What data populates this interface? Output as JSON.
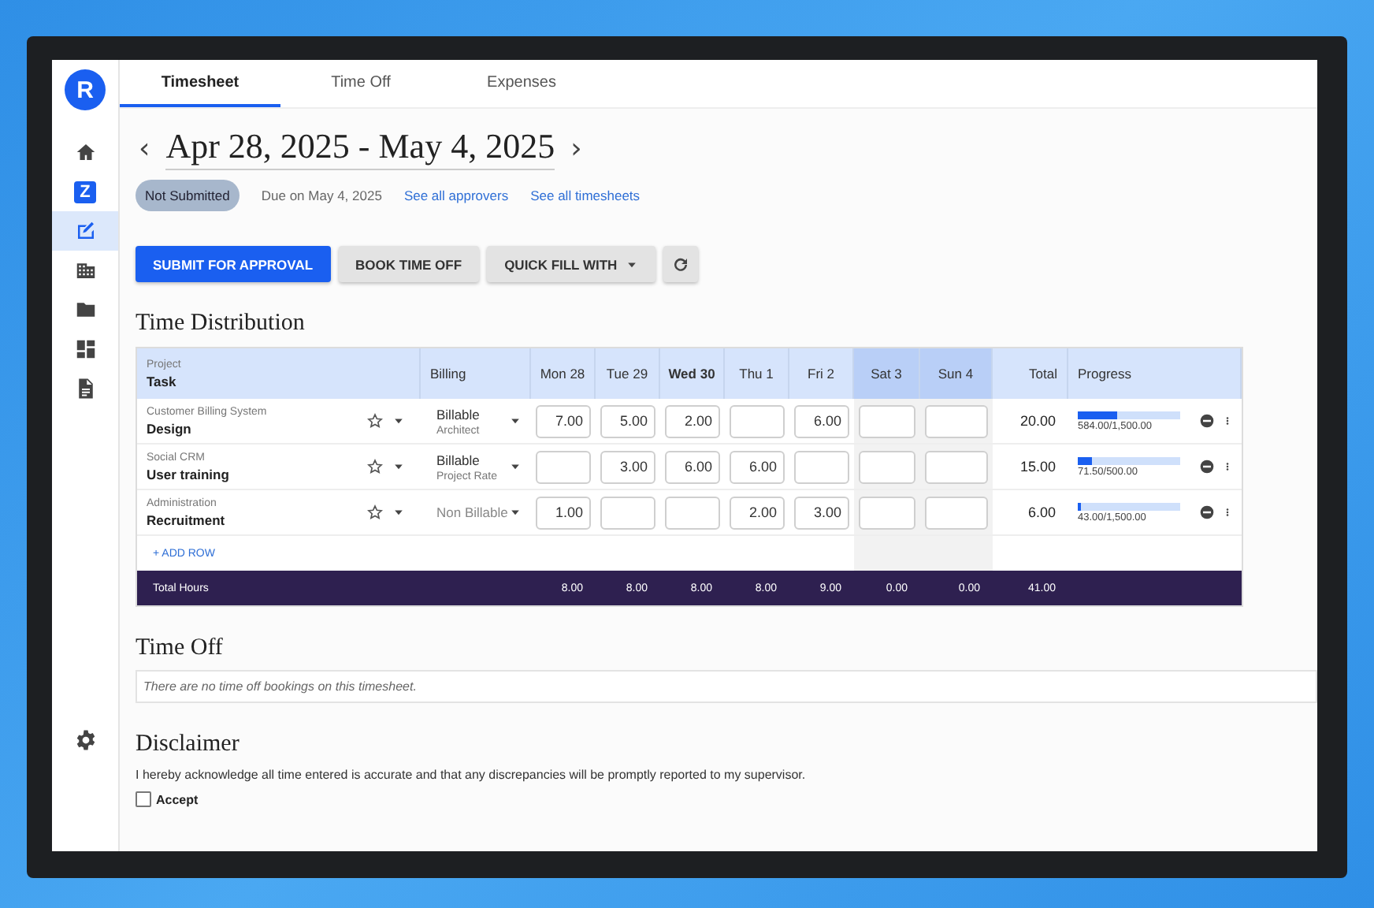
{
  "sidebar": {
    "logo": "R",
    "items": [
      {
        "kind": "home",
        "selected": false
      },
      {
        "kind": "letter",
        "text": "Z",
        "selected": false
      },
      {
        "kind": "timesheet",
        "selected": true
      },
      {
        "kind": "building",
        "selected": false
      },
      {
        "kind": "folder",
        "selected": false
      },
      {
        "kind": "dashboard",
        "selected": false
      },
      {
        "kind": "document",
        "selected": false
      }
    ],
    "bottom": {
      "kind": "settings",
      "selected": false
    }
  },
  "tabs": [
    {
      "label": "Timesheet",
      "selected": true
    },
    {
      "label": "Time Off",
      "selected": false
    },
    {
      "label": "Expenses",
      "selected": false
    }
  ],
  "period": {
    "prev": "‹",
    "title": "Apr 28, 2025 - May 4, 2025",
    "next": "›"
  },
  "status": {
    "chip": "Not Submitted",
    "due": "Due on May 4, 2025",
    "links": [
      "See all approvers",
      "See all timesheets"
    ]
  },
  "actions": [
    {
      "kind": "primary",
      "label": "SUBMIT FOR APPROVAL"
    },
    {
      "kind": "plain",
      "label": "BOOK TIME OFF"
    },
    {
      "kind": "menu",
      "label": "QUICK FILL WITH"
    },
    {
      "kind": "refresh"
    }
  ],
  "time_distribution": {
    "title": "Time Distribution",
    "header": {
      "project": "Project",
      "task": "Task",
      "billing": "Billing",
      "total": "Total",
      "progress": "Progress"
    },
    "days": [
      {
        "label": "Mon 28",
        "weekend": false,
        "current": false
      },
      {
        "label": "Tue 29",
        "weekend": false,
        "current": false
      },
      {
        "label": "Wed 30",
        "weekend": false,
        "current": true
      },
      {
        "label": "Thu 1",
        "weekend": false,
        "current": false
      },
      {
        "label": "Fri 2",
        "weekend": false,
        "current": false
      },
      {
        "label": "Sat 3",
        "weekend": true,
        "current": false
      },
      {
        "label": "Sun 4",
        "weekend": true,
        "current": false
      }
    ],
    "rows": [
      {
        "project": "Customer Billing System",
        "task": "Design",
        "starred": false,
        "billing": "Billable",
        "billable": true,
        "rate": "Architect",
        "hours": {
          "0": "7.00",
          "1": "5.00",
          "2": "2.00",
          "4": "6.00"
        },
        "total": "20.00",
        "level": 0.389,
        "progress": "584.00/1,500.00"
      },
      {
        "project": "Social CRM",
        "task": "User training",
        "starred": false,
        "billing": "Billable",
        "billable": true,
        "rate": "Project Rate",
        "hours": {
          "1": "3.00",
          "2": "6.00",
          "3": "6.00"
        },
        "total": "15.00",
        "level": 0.143,
        "progress": "71.50/500.00"
      },
      {
        "project": "Administration",
        "task": "Recruitment",
        "starred": false,
        "billing": "Non Billable",
        "billable": false,
        "hours": {
          "0": "1.00",
          "3": "2.00",
          "4": "3.00"
        },
        "total": "6.00",
        "level": 0.029,
        "progress": "43.00/1,500.00"
      }
    ],
    "add_row": "+ ADD ROW",
    "totals": {
      "label": "Total Hours",
      "values": [
        "8.00",
        "8.00",
        "8.00",
        "8.00",
        "9.00",
        "0.00",
        "0.00"
      ],
      "total": "41.00"
    }
  },
  "time_off": {
    "title": "Time Off",
    "notice": "There are no time off bookings on this timesheet."
  },
  "disclaimer": {
    "title": "Disclaimer",
    "text": "I hereby acknowledge all time entered is accurate and that any discrepancies will be promptly reported to my supervisor.",
    "accept": {
      "label": "Accept",
      "checked": false
    }
  }
}
